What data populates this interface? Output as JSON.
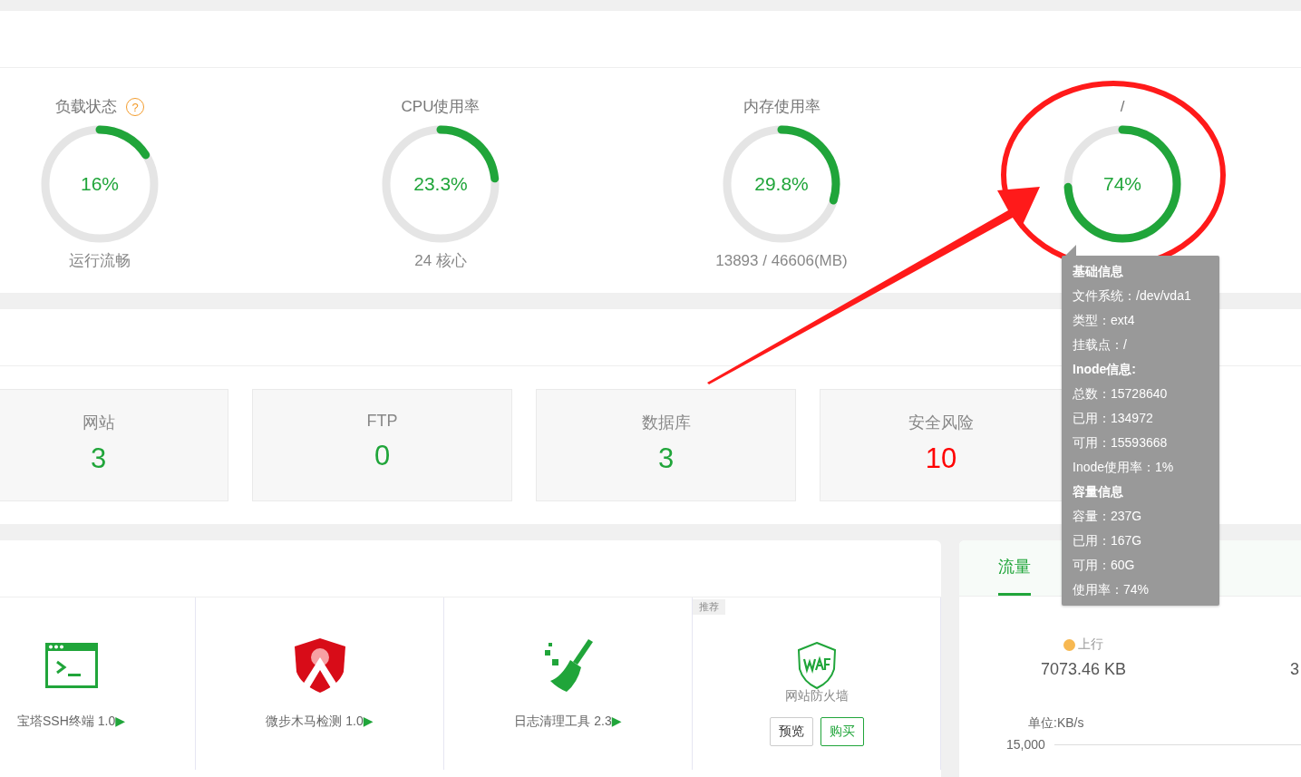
{
  "gauges": [
    {
      "title": "负载状态",
      "help_icon": "?",
      "value": "16%",
      "level": 0.16,
      "caption": "运行流畅"
    },
    {
      "title": "CPU使用率",
      "value": "23.3%",
      "level": 0.233,
      "caption": "24 核心"
    },
    {
      "title": "内存使用率",
      "value": "29.8%",
      "level": 0.298,
      "caption": "13893 / 46606(MB)"
    },
    {
      "title": "/",
      "value": "74%",
      "level": 0.74
    }
  ],
  "stats": [
    {
      "label": "网站",
      "count": "3",
      "color": "#20a53a"
    },
    {
      "label": "FTP",
      "count": "0",
      "color": "#20a53a"
    },
    {
      "label": "数据库",
      "count": "3",
      "color": "#20a53a"
    },
    {
      "label": "安全风险",
      "count": "10",
      "color": "#ff0000"
    }
  ],
  "software": [
    {
      "kind": "terminal",
      "name": "宝塔SSH终端 1.0",
      "play": "▶"
    },
    {
      "kind": "shield",
      "name": "微步木马检测 1.0",
      "play": "▶"
    },
    {
      "kind": "broom",
      "name": "日志清理工具 2.3",
      "play": "▶"
    },
    {
      "kind": "waf",
      "tag": "推荐",
      "name": "网站防火墙",
      "buttons": [
        {
          "label": "预览",
          "kind": "plain"
        },
        {
          "label": "购买",
          "kind": "green"
        }
      ]
    }
  ],
  "traffic": {
    "tabs": [
      {
        "label": "流量",
        "selected": true
      }
    ],
    "columns": [
      {
        "label": "上行",
        "color": "#f7b851",
        "value": "7073.46 KB"
      },
      {
        "value": "3"
      }
    ],
    "unit": "单位:KB/s",
    "y_tick": "15,000"
  },
  "tooltip": {
    "lines": [
      {
        "kind": "heading",
        "text": "基础信息"
      },
      {
        "kind": "line",
        "text": "文件系统：/dev/vda1"
      },
      {
        "kind": "line",
        "text": "类型：ext4"
      },
      {
        "kind": "line",
        "text": "挂载点：/"
      },
      {
        "kind": "heading",
        "text": "Inode信息:"
      },
      {
        "kind": "line",
        "text": "总数：15728640"
      },
      {
        "kind": "line",
        "text": "已用：134972"
      },
      {
        "kind": "line",
        "text": "可用：15593668"
      },
      {
        "kind": "line",
        "text": "Inode使用率：1%"
      },
      {
        "kind": "heading",
        "text": "容量信息"
      },
      {
        "kind": "line",
        "text": "容量：237G"
      },
      {
        "kind": "line",
        "text": "已用：167G"
      },
      {
        "kind": "line",
        "text": "可用：60G"
      },
      {
        "kind": "line",
        "text": "使用率：74%"
      }
    ]
  }
}
